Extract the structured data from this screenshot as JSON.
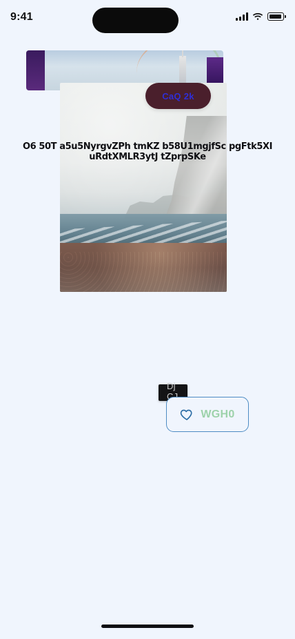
{
  "status_bar": {
    "time": "9:41"
  },
  "media": {
    "back_card_icon": "image-photo",
    "main_image_icon": "beach-cliffs-photo"
  },
  "content": {
    "caption": "O6 50T a5u5NyrgvZPh tmKZ b58U1mgjfSc pgFtk5XI uRdtXMLR3ytJ tZprpSKe",
    "pill_button_label": "CaQ 2k",
    "tooltip_text": "Dj CJ",
    "outline_button_label": "WGH0",
    "outline_button_icon": "heart-outline-icon"
  },
  "colors": {
    "background": "#f0f5fd",
    "pill_background": "#4a1f2c",
    "pill_text": "#2f2ed6",
    "tooltip_background": "#141416",
    "tooltip_text": "#c9c9c9",
    "outline_button_border": "#4d8bc3",
    "outline_button_text": "#9dd2aa",
    "heart_icon": "#2d6ea6"
  }
}
